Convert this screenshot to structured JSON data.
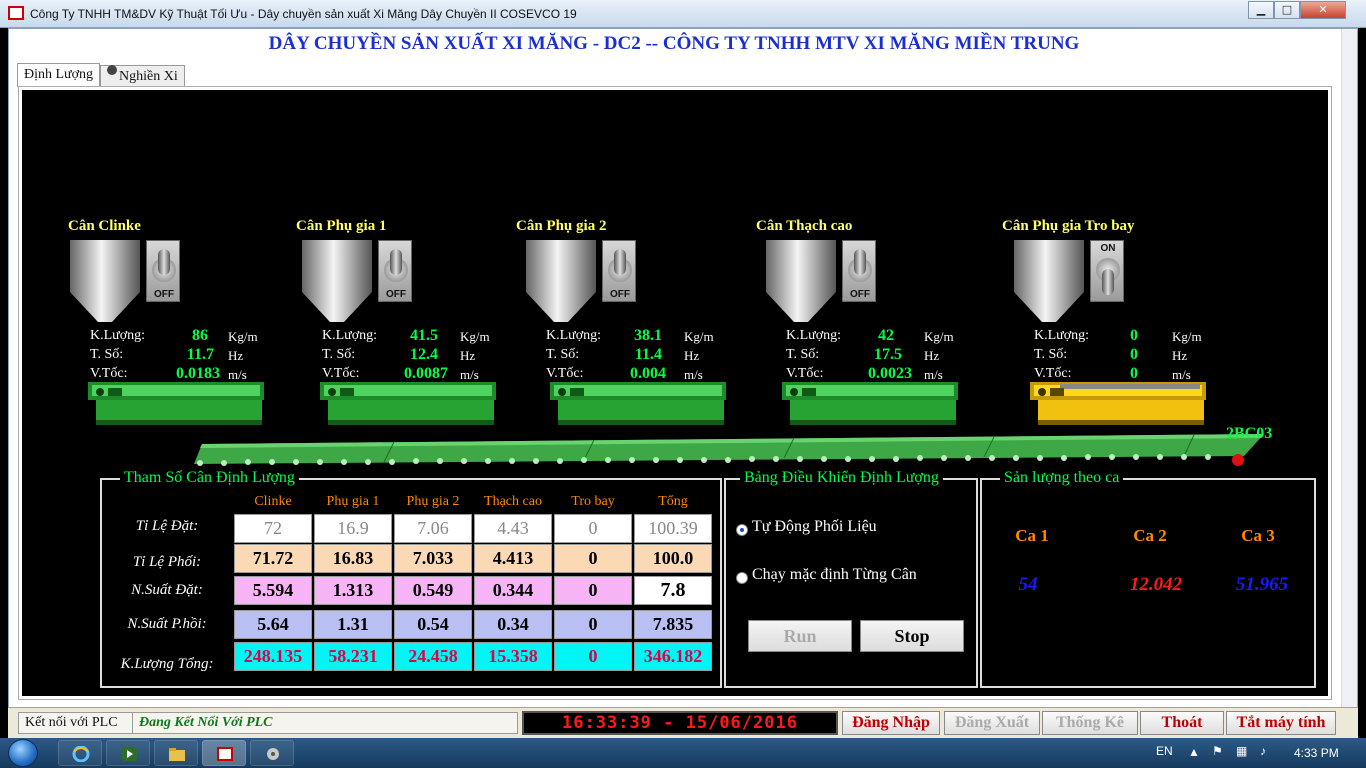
{
  "window": {
    "title": "Công Ty TNHH TM&DV Kỹ Thuật Tối Ưu - Dây chuyền sản xuất Xi Măng Dây Chuyền II COSEVCO 19",
    "minimize": "▁",
    "maximize": "□",
    "close": "✕"
  },
  "banner": "DÂY CHUYỀN SẢN XUẤT XI MĂNG - DC2 -- CÔNG TY TNHH MTV XI MĂNG MIỀN TRUNG",
  "tabs": [
    "Định Lượng",
    "Nghiền Xi"
  ],
  "labels": {
    "kl": "K.Lượng:",
    "ts": "T. Số:",
    "vt": "V.Tốc:",
    "u_kl": "Kg/m",
    "u_ts": "Hz",
    "u_vt": "m/s"
  },
  "scales": [
    {
      "name": "Cân Clinke",
      "switch": "OFF",
      "kl": "86",
      "ts": "11.7",
      "vt": "0.0183",
      "state": "off"
    },
    {
      "name": "Cân  Phụ gia 1",
      "switch": "OFF",
      "kl": "41.5",
      "ts": "12.4",
      "vt": "0.0087",
      "state": "off"
    },
    {
      "name": "Cân  Phụ gia 2",
      "switch": "OFF",
      "kl": "38.1",
      "ts": "11.4",
      "vt": "0.004",
      "state": "off"
    },
    {
      "name": "Cân  Thạch cao",
      "switch": "OFF",
      "kl": "42",
      "ts": "17.5",
      "vt": "0.0023",
      "state": "off"
    },
    {
      "name": "Cân Phụ gia Tro bay",
      "switch": "ON",
      "kl": "0",
      "ts": "0",
      "vt": "0",
      "state": "on"
    }
  ],
  "conveyor": {
    "label": "2BC03"
  },
  "params": {
    "title": "Tham Số Cân Định Lượng",
    "columns": [
      "Clinke",
      "Phụ gia 1",
      "Phụ gia 2",
      "Thạch cao",
      "Tro bay",
      "Tổng"
    ],
    "rows": [
      {
        "label": "Tỉ Lệ Đặt:",
        "values": [
          "72",
          "16.9",
          "7.06",
          "4.43",
          "0",
          "100.39"
        ]
      },
      {
        "label": "Tỉ Lệ Phối:",
        "values": [
          "71.72",
          "16.83",
          "7.033",
          "4.413",
          "0",
          "100.0"
        ]
      },
      {
        "label": "N.Suất Đặt:",
        "values": [
          "5.594",
          "1.313",
          "0.549",
          "0.344",
          "0",
          "7.8"
        ]
      },
      {
        "label": "N.Suất P.hồi:",
        "values": [
          "5.64",
          "1.31",
          "0.54",
          "0.34",
          "0",
          "7.835"
        ]
      },
      {
        "label": "K.Lượng Tổng:",
        "values": [
          "248.135",
          "58.231",
          "24.458",
          "15.358",
          "0",
          "346.182"
        ]
      }
    ]
  },
  "control": {
    "title": "Bảng Điều Khiển Định Lượng",
    "auto_label": "Tự Động Phối Liệu",
    "manual_label": "Chạy mặc định Từng Cân",
    "selected": "auto",
    "run_label": "Run",
    "stop_label": "Stop"
  },
  "shift": {
    "title": "Sản lượng theo ca",
    "shifts": [
      {
        "label": "Ca 1",
        "value": "54",
        "color": "#1a1aff"
      },
      {
        "label": "Ca 2",
        "value": "12.042",
        "color": "#ff1a1a"
      },
      {
        "label": "Ca 3",
        "value": "51.965",
        "color": "#1a1aff"
      }
    ]
  },
  "status": {
    "plc_label": "Kết nối với PLC",
    "plc_status": "Đang Kết Nối Với PLC",
    "clock": "16:33:39 - 15/06/2016",
    "login": "Đăng Nhập",
    "logout": "Đăng Xuất",
    "stats": "Thống Kê",
    "exit": "Thoát",
    "shutdown": "Tắt máy tính"
  },
  "taskbar": {
    "lang": "EN",
    "time": "4:33 PM"
  },
  "colors": {
    "accent": "#1b2fd1",
    "on_green": "#00ff44",
    "title_yellow": "#ffff66",
    "header_orange": "#ff8800",
    "status_red": "#e00000"
  }
}
